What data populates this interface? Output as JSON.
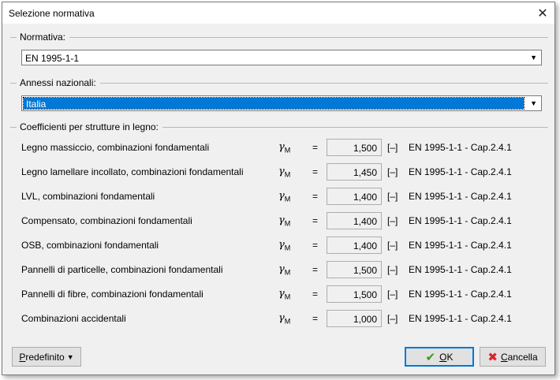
{
  "window": {
    "title": "Selezione normativa"
  },
  "normativa": {
    "label": "Normativa:",
    "value": "EN 1995-1-1"
  },
  "annessi": {
    "label": "Annessi nazionali:",
    "value": "Italia"
  },
  "coefficients": {
    "label": "Coefficienti per strutture in legno:",
    "gamma_symbol": "γ",
    "gamma_sub": "M",
    "rows": [
      {
        "label": "Legno massiccio, combinazioni fondamentali",
        "value": "1,500",
        "unit": "[–]",
        "ref": "EN 1995-1-1 - Cap.2.4.1"
      },
      {
        "label": "Legno lamellare incollato, combinazioni fondamentali",
        "value": "1,450",
        "unit": "[–]",
        "ref": "EN 1995-1-1 - Cap.2.4.1"
      },
      {
        "label": "LVL, combinazioni fondamentali",
        "value": "1,400",
        "unit": "[–]",
        "ref": "EN 1995-1-1 - Cap.2.4.1"
      },
      {
        "label": "Compensato, combinazioni fondamentali",
        "value": "1,400",
        "unit": "[–]",
        "ref": "EN 1995-1-1 - Cap.2.4.1"
      },
      {
        "label": "OSB, combinazioni fondamentali",
        "value": "1,400",
        "unit": "[–]",
        "ref": "EN 1995-1-1 - Cap.2.4.1"
      },
      {
        "label": "Pannelli di particelle, combinazioni fondamentali",
        "value": "1,500",
        "unit": "[–]",
        "ref": "EN 1995-1-1 - Cap.2.4.1"
      },
      {
        "label": "Pannelli di fibre, combinazioni fondamentali",
        "value": "1,500",
        "unit": "[–]",
        "ref": "EN 1995-1-1 - Cap.2.4.1"
      },
      {
        "label": "Combinazioni accidentali",
        "value": "1,000",
        "unit": "[–]",
        "ref": "EN 1995-1-1 - Cap.2.4.1"
      }
    ]
  },
  "buttons": {
    "predefinito_first": "P",
    "predefinito_rest": "redefinito",
    "ok_first": "O",
    "ok_rest": "K",
    "cancel_first": "C",
    "cancel_rest": "ancella"
  },
  "icons": {
    "close": "close-icon",
    "ok": "check-icon",
    "cancel": "x-icon",
    "dropdown": "chevron-down-icon"
  },
  "colors": {
    "selection": "#0078d7",
    "ok_check": "#3a9a1a",
    "cancel_x": "#d8232a"
  }
}
